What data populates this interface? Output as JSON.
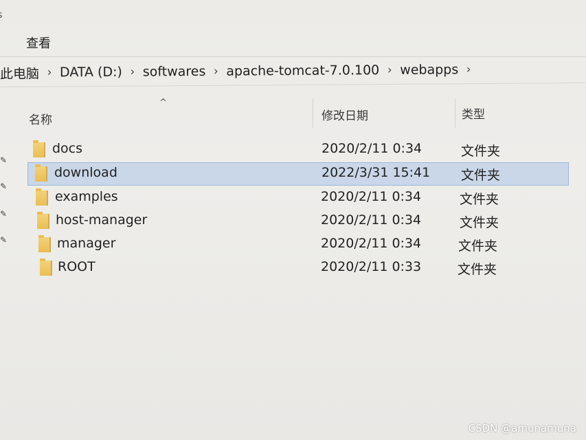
{
  "ribbon": {
    "view_tab": "查看"
  },
  "address_bar": {
    "crumbs": [
      "此电脑",
      "DATA (D:)",
      "softwares",
      "apache-tomcat-7.0.100",
      "webapps"
    ],
    "separator": "›"
  },
  "columns": {
    "name": "名称",
    "date": "修改日期",
    "type": "类型"
  },
  "files": [
    {
      "name": "docs",
      "date": "2020/2/11 0:34",
      "type": "文件夹",
      "selected": false
    },
    {
      "name": "download",
      "date": "2022/3/31 15:41",
      "type": "文件夹",
      "selected": true
    },
    {
      "name": "examples",
      "date": "2020/2/11 0:34",
      "type": "文件夹",
      "selected": false
    },
    {
      "name": "host-manager",
      "date": "2020/2/11 0:34",
      "type": "文件夹",
      "selected": false
    },
    {
      "name": "manager",
      "date": "2020/2/11 0:34",
      "type": "文件夹",
      "selected": false
    },
    {
      "name": "ROOT",
      "date": "2020/2/11 0:33",
      "type": "文件夹",
      "selected": false
    }
  ],
  "watermark": "CSDN @amunamuna",
  "colors": {
    "selection": "#c9d7e8",
    "selection_border": "#9db7d6",
    "folder": "#e8bf57"
  },
  "icons": {
    "folder": "folder-icon",
    "pin": "pin-icon",
    "sort": "sort-up-icon"
  }
}
